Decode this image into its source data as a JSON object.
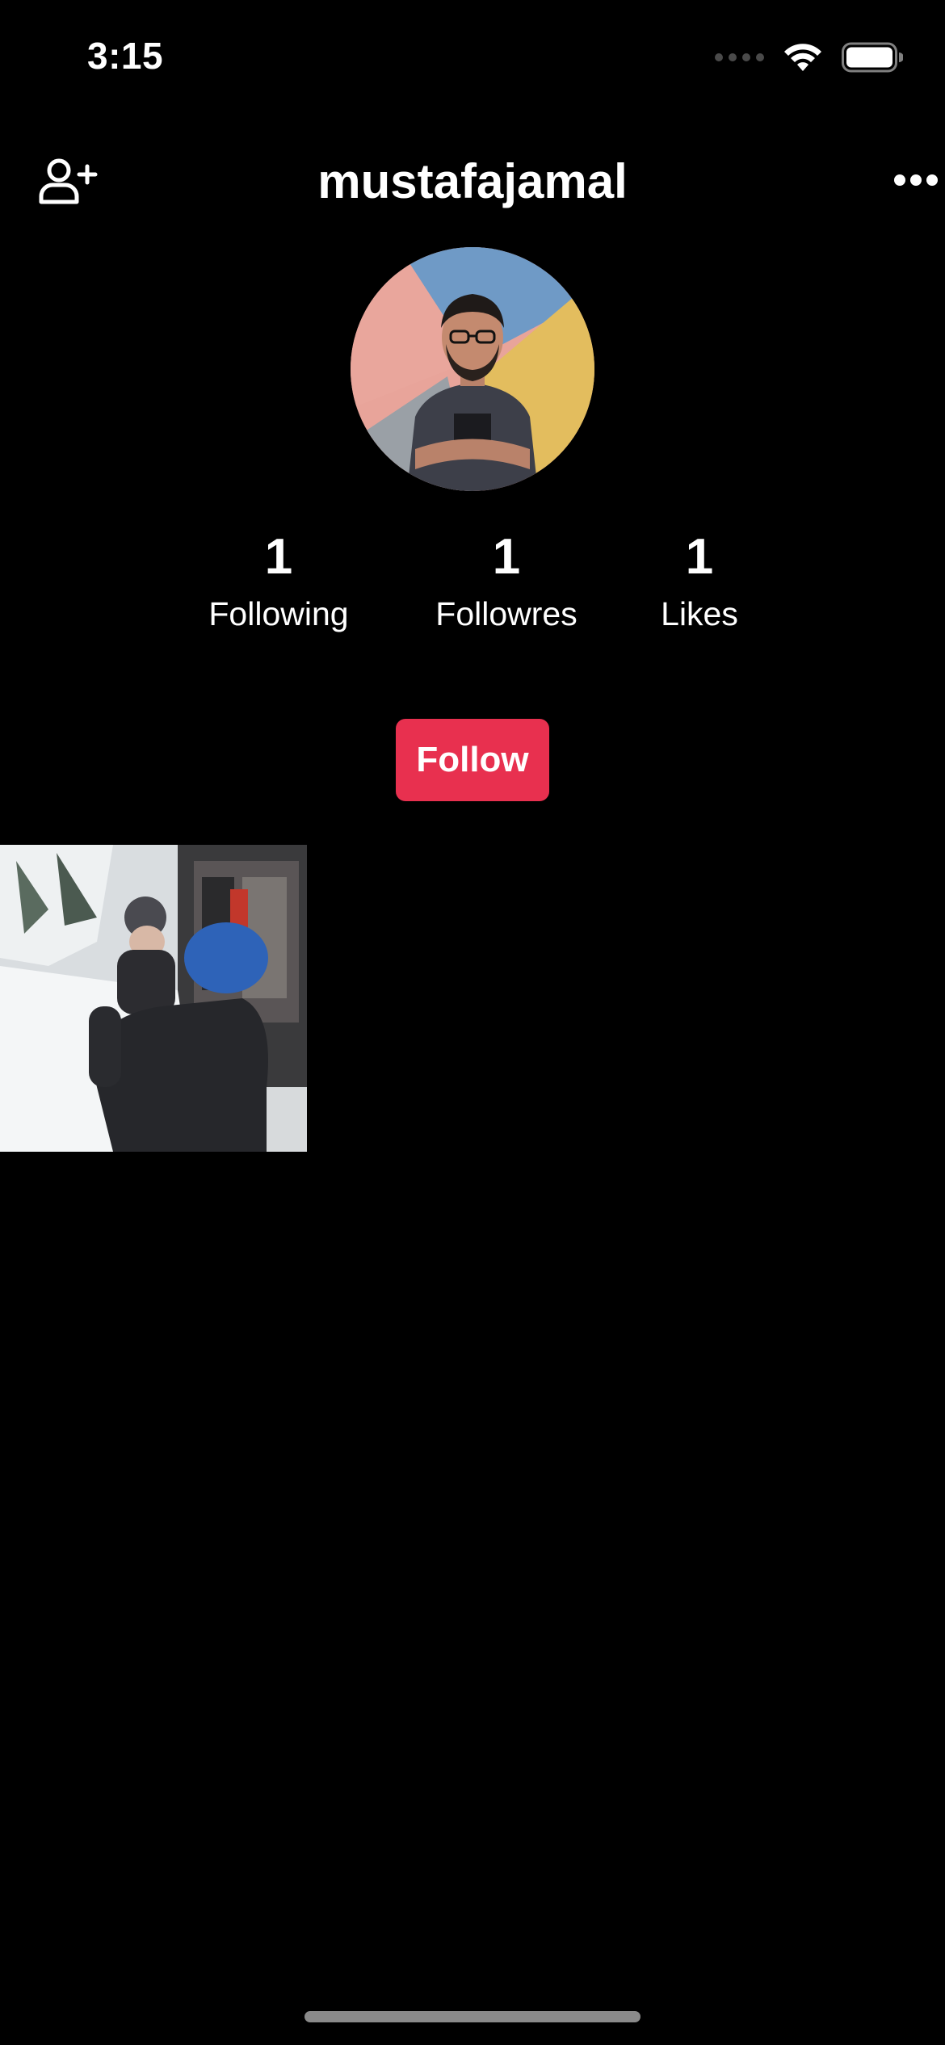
{
  "status_bar": {
    "time": "3:15",
    "icons": [
      "signal-dots-icon",
      "wifi-icon",
      "battery-icon"
    ]
  },
  "header": {
    "username": "mustafajamal",
    "left_icon": "add-user-icon",
    "right_icon": "more-icon"
  },
  "stats": [
    {
      "value": "1",
      "label": "Following"
    },
    {
      "value": "1",
      "label": "Followres"
    },
    {
      "value": "1",
      "label": "Likes"
    }
  ],
  "follow_button": {
    "label": "Follow"
  },
  "colors": {
    "background": "#000000",
    "accent": "#E8304F",
    "text": "#FFFFFF"
  }
}
